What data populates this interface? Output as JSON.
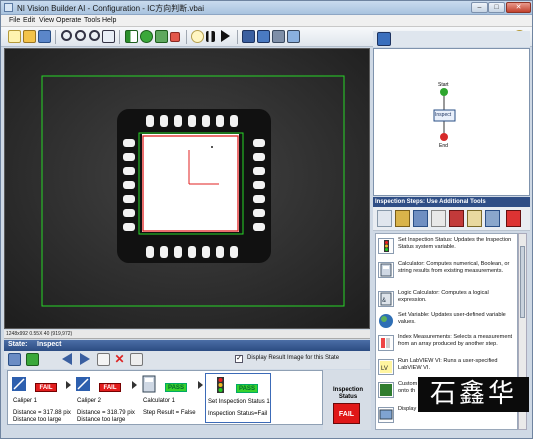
{
  "window": {
    "title": "NI Vision Builder AI - Configuration - IC方向判断.vbai"
  },
  "window_controls": {
    "minimize": "–",
    "maximize": "□",
    "close": "✕"
  },
  "menu": [
    "File",
    "Edit",
    "View",
    "Operate",
    "Tools",
    "Help"
  ],
  "toolbar": {
    "icons": [
      "new-icon",
      "open-icon",
      "save-icon",
      "zoom-in-icon",
      "zoom-out-icon",
      "zoom-fit-icon",
      "zoom-1to1-icon",
      "run-once-icon",
      "run-loop-icon",
      "step-icon",
      "stop-icon",
      "light-icon",
      "pause-icon",
      "next-icon",
      "image-icon",
      "run-state-icon",
      "results-icon",
      "help-icon"
    ]
  },
  "viewer": {
    "status": "1248x992 0.55X 40     (919,972)"
  },
  "flowchart": {
    "start": "Start",
    "inspect": "Inspect",
    "end": "End"
  },
  "steps_panel": {
    "title": "Inspection Steps: Use Additional Tools",
    "items": [
      {
        "icon": "traffic-light-icon",
        "text": "Set Inspection Status: Updates the Inspection Status system variable."
      },
      {
        "icon": "calculator-icon",
        "text": "Calculator: Computes numerical, Boolean, or string results from existing measurements."
      },
      {
        "icon": "logic-calculator-icon",
        "text": "Logic Calculator: Computes a logical expression."
      },
      {
        "icon": "globe-variable-icon",
        "text": "Set Variable: Updates user-defined variable values."
      },
      {
        "icon": "index-icon",
        "text": "Index Measurements: Selects a measurement from an array produced by another step."
      },
      {
        "icon": "labview-icon",
        "text": "Run LabVIEW VI: Runs a user-specified LabVIEW VI."
      },
      {
        "icon": "custom-overlay-icon",
        "text": "Custom"
      },
      {
        "icon": "display-icon",
        "text": "Display"
      }
    ],
    "partial_text": "onto th"
  },
  "state": {
    "label": "State:",
    "value": "Inspect"
  },
  "display_result": {
    "checked": true,
    "label": "Display Result Image for this State"
  },
  "steps": [
    {
      "name": "Caliper 1",
      "status": "FAIL",
      "line1": "Distance = 317.88 pix",
      "line2": "Distance too large"
    },
    {
      "name": "Caliper 2",
      "status": "FAIL",
      "line1": "Distance = 318.79 pix",
      "line2": "Distance too large"
    },
    {
      "name": "Calculator 1",
      "status": "PASS",
      "line1": "Step Result = False",
      "line2": ""
    },
    {
      "name": "Set Inspection Status 1",
      "status": "PASS",
      "line1": "Inspection Status=Fail",
      "line2": ""
    }
  ],
  "inspection": {
    "title": "Inspection Status",
    "result": "FAIL"
  },
  "watermark": "石鑫华"
}
